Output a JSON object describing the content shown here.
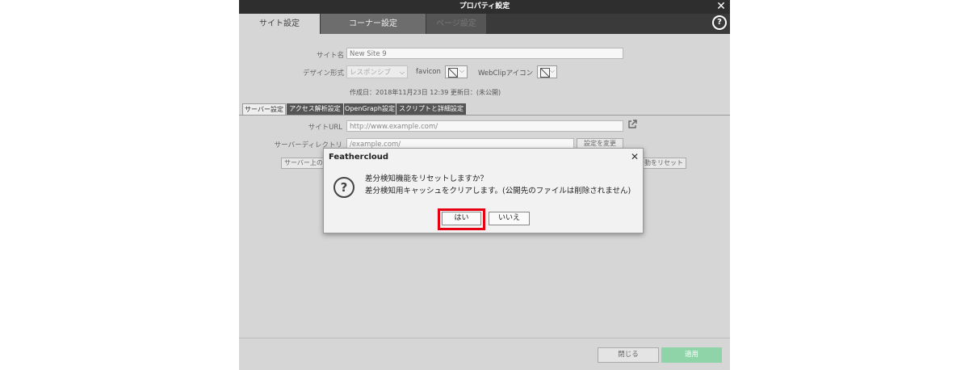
{
  "window": {
    "title": "プロパティ設定",
    "tabs": [
      "サイト設定",
      "コーナー設定",
      "ページ設定"
    ]
  },
  "form": {
    "site_name_label": "サイト名",
    "site_name_value": "New Site 9",
    "design_label": "デザイン形式",
    "design_value": "レスポンシブ",
    "favicon_label": "favicon",
    "webclip_label": "WebClipアイコン",
    "dates": "作成日：2018年11月23日 12:39 更新日：(未公開)"
  },
  "subtabs": [
    "サーバー設定",
    "アクセス解析設定",
    "OpenGraph設定",
    "スクリプトと詳細設定"
  ],
  "server": {
    "site_url_label": "サイトURL",
    "site_url_placeholder": "http://www.example.com/",
    "dir_label": "サーバーディレクトリ",
    "dir_placeholder": "/example.com/",
    "change_button": "設定を変更",
    "server_left_button": "サーバー上の",
    "reset_button_fragment": "動をリセット"
  },
  "footer": {
    "close_label": "閉じる",
    "apply_label": "適用"
  },
  "dialog": {
    "title": "Feathercloud",
    "message_line1": "差分検知機能をリセットしますか？",
    "message_line2": "差分検知用キャッシュをクリアします。(公開先のファイルは削除されません)",
    "yes_label": "はい",
    "no_label": "いいえ",
    "highlight_color": "#e60012"
  },
  "colors": {
    "apply_button": "#8fd3a8",
    "titlebar": "#2e2e2e"
  }
}
